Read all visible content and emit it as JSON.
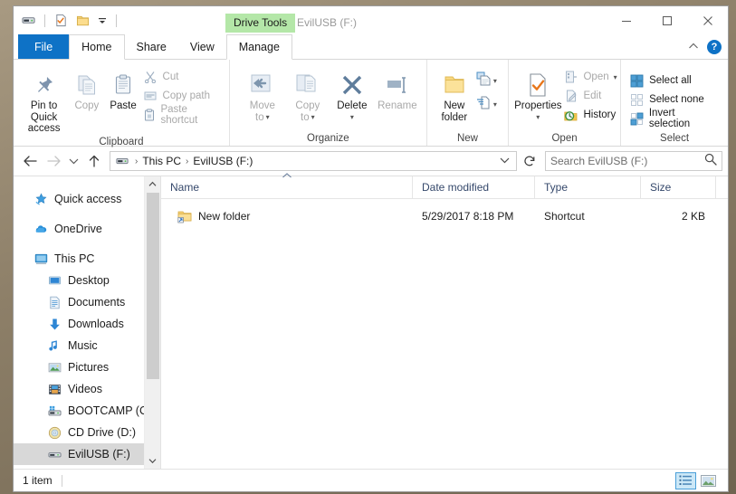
{
  "window": {
    "title": "EvilUSB (F:)",
    "contextual_tab_label": "Drive Tools",
    "minimize": "—",
    "maximize": "☐",
    "close": "✕"
  },
  "quick_access_toolbar": {
    "items": [
      {
        "name": "drive-icon",
        "label": ""
      },
      {
        "name": "properties-icon",
        "label": ""
      },
      {
        "name": "new-folder-icon",
        "label": ""
      },
      {
        "name": "customize-caret",
        "label": "▼"
      }
    ]
  },
  "tabs": [
    {
      "id": "file",
      "label": "File",
      "state": "file"
    },
    {
      "id": "home",
      "label": "Home",
      "state": "active"
    },
    {
      "id": "share",
      "label": "Share",
      "state": "normal"
    },
    {
      "id": "view",
      "label": "View",
      "state": "normal"
    },
    {
      "id": "manage",
      "label": "Manage",
      "state": "ctx-active"
    }
  ],
  "tabstrip_right": {
    "collapse_ribbon": "⌃",
    "help": "?"
  },
  "ribbon": {
    "groups": [
      {
        "label": "Clipboard",
        "big_buttons": [
          {
            "label": "Pin to Quick\naccess",
            "line1": "Pin to Quick",
            "line2": "access",
            "icon": "pin-icon",
            "disabled": false
          },
          {
            "label": "Copy",
            "line1": "Copy",
            "line2": "",
            "icon": "copy-icon",
            "disabled": true
          },
          {
            "label": "Paste",
            "line1": "Paste",
            "line2": "",
            "icon": "paste-icon",
            "disabled": false
          }
        ],
        "small_buttons": [
          {
            "label": "Cut",
            "icon": "scissors-icon",
            "disabled": true
          },
          {
            "label": "Copy path",
            "icon": "copy-path-icon",
            "disabled": true
          },
          {
            "label": "Paste shortcut",
            "icon": "paste-shortcut-icon",
            "disabled": true
          }
        ]
      },
      {
        "label": "Organize",
        "big_buttons": [
          {
            "line1": "Move",
            "line2": "to",
            "icon": "move-to-icon",
            "disabled": true,
            "caret": true
          },
          {
            "line1": "Copy",
            "line2": "to",
            "icon": "copy-to-icon",
            "disabled": true,
            "caret": true
          },
          {
            "line1": "Delete",
            "line2": "",
            "icon": "delete-icon",
            "disabled": false,
            "caret": true
          },
          {
            "line1": "Rename",
            "line2": "",
            "icon": "rename-icon",
            "disabled": true,
            "caret": false
          }
        ],
        "small_buttons": []
      },
      {
        "label": "New",
        "big_buttons": [
          {
            "line1": "New",
            "line2": "folder",
            "icon": "new-folder-icon",
            "disabled": false
          }
        ],
        "split_buttons": [
          {
            "icon": "new-item-icon",
            "caret": "▾"
          },
          {
            "icon": "easy-access-icon",
            "caret": "▾"
          }
        ],
        "small_buttons": []
      },
      {
        "label": "Open",
        "big_buttons": [
          {
            "line1": "Properties",
            "line2": "",
            "icon": "properties-icon",
            "disabled": false,
            "caret": true
          }
        ],
        "small_buttons": [
          {
            "label": "Open",
            "icon": "open-icon",
            "disabled": true,
            "caret": "▾"
          },
          {
            "label": "Edit",
            "icon": "edit-icon",
            "disabled": true
          },
          {
            "label": "History",
            "icon": "history-icon",
            "disabled": false
          }
        ]
      },
      {
        "label": "Select",
        "big_buttons": [],
        "small_buttons": [
          {
            "label": "Select all",
            "icon": "select-all-icon",
            "disabled": false
          },
          {
            "label": "Select none",
            "icon": "select-none-icon",
            "disabled": false
          },
          {
            "label": "Invert selection",
            "icon": "invert-selection-icon",
            "disabled": false
          }
        ]
      }
    ]
  },
  "address_bar": {
    "back": "←",
    "forward": "→",
    "recent": "⌄",
    "up": "↑",
    "breadcrumbs": [
      "This PC",
      "EvilUSB (F:)"
    ],
    "separator": "›",
    "dropdown_caret": "⌄",
    "refresh": "↻",
    "search_placeholder": "Search EvilUSB (F:)"
  },
  "nav_pane": {
    "items": [
      {
        "label": "Quick access",
        "icon": "star-icon",
        "indent": false,
        "selected": false,
        "gap_after": true
      },
      {
        "label": "OneDrive",
        "icon": "cloud-icon",
        "indent": false,
        "selected": false,
        "gap_after": true
      },
      {
        "label": "This PC",
        "icon": "monitor-icon",
        "indent": false,
        "selected": false,
        "gap_after": false
      },
      {
        "label": "Desktop",
        "icon": "desktop-icon",
        "indent": true,
        "selected": false,
        "gap_after": false
      },
      {
        "label": "Documents",
        "icon": "documents-icon",
        "indent": true,
        "selected": false,
        "gap_after": false
      },
      {
        "label": "Downloads",
        "icon": "download-icon",
        "indent": true,
        "selected": false,
        "gap_after": false
      },
      {
        "label": "Music",
        "icon": "music-icon",
        "indent": true,
        "selected": false,
        "gap_after": false
      },
      {
        "label": "Pictures",
        "icon": "pictures-icon",
        "indent": true,
        "selected": false,
        "gap_after": false
      },
      {
        "label": "Videos",
        "icon": "videos-icon",
        "indent": true,
        "selected": false,
        "gap_after": false
      },
      {
        "label": "BOOTCAMP (C:)",
        "icon": "harddrive-icon",
        "indent": true,
        "selected": false,
        "gap_after": false
      },
      {
        "label": "CD Drive (D:)",
        "icon": "cd-icon",
        "indent": true,
        "selected": false,
        "gap_after": false
      },
      {
        "label": "EvilUSB (F:)",
        "icon": "usb-icon",
        "indent": true,
        "selected": true,
        "gap_after": false
      }
    ],
    "scroll_up": "⌃",
    "scroll_down": "⌄"
  },
  "file_list": {
    "columns": [
      {
        "key": "name",
        "label": "Name",
        "sorted": true,
        "sort_indicator": "⌃"
      },
      {
        "key": "date",
        "label": "Date modified",
        "sorted": false
      },
      {
        "key": "type",
        "label": "Type",
        "sorted": false
      },
      {
        "key": "size",
        "label": "Size",
        "sorted": false
      }
    ],
    "rows": [
      {
        "name": "New folder",
        "date": "5/29/2017 8:18 PM",
        "type": "Shortcut",
        "size": "2 KB",
        "icon": "folder-shortcut-icon"
      }
    ]
  },
  "status_bar": {
    "item_count": "1 item",
    "view_buttons": [
      {
        "name": "details-view-button",
        "active": true
      },
      {
        "name": "large-icons-view-button",
        "active": false
      }
    ]
  },
  "colors": {
    "accent_blue": "#0e72c6",
    "contextual_green": "#b4e7a8",
    "selection_gray": "#d8d8d8",
    "header_text": "#35486b"
  }
}
